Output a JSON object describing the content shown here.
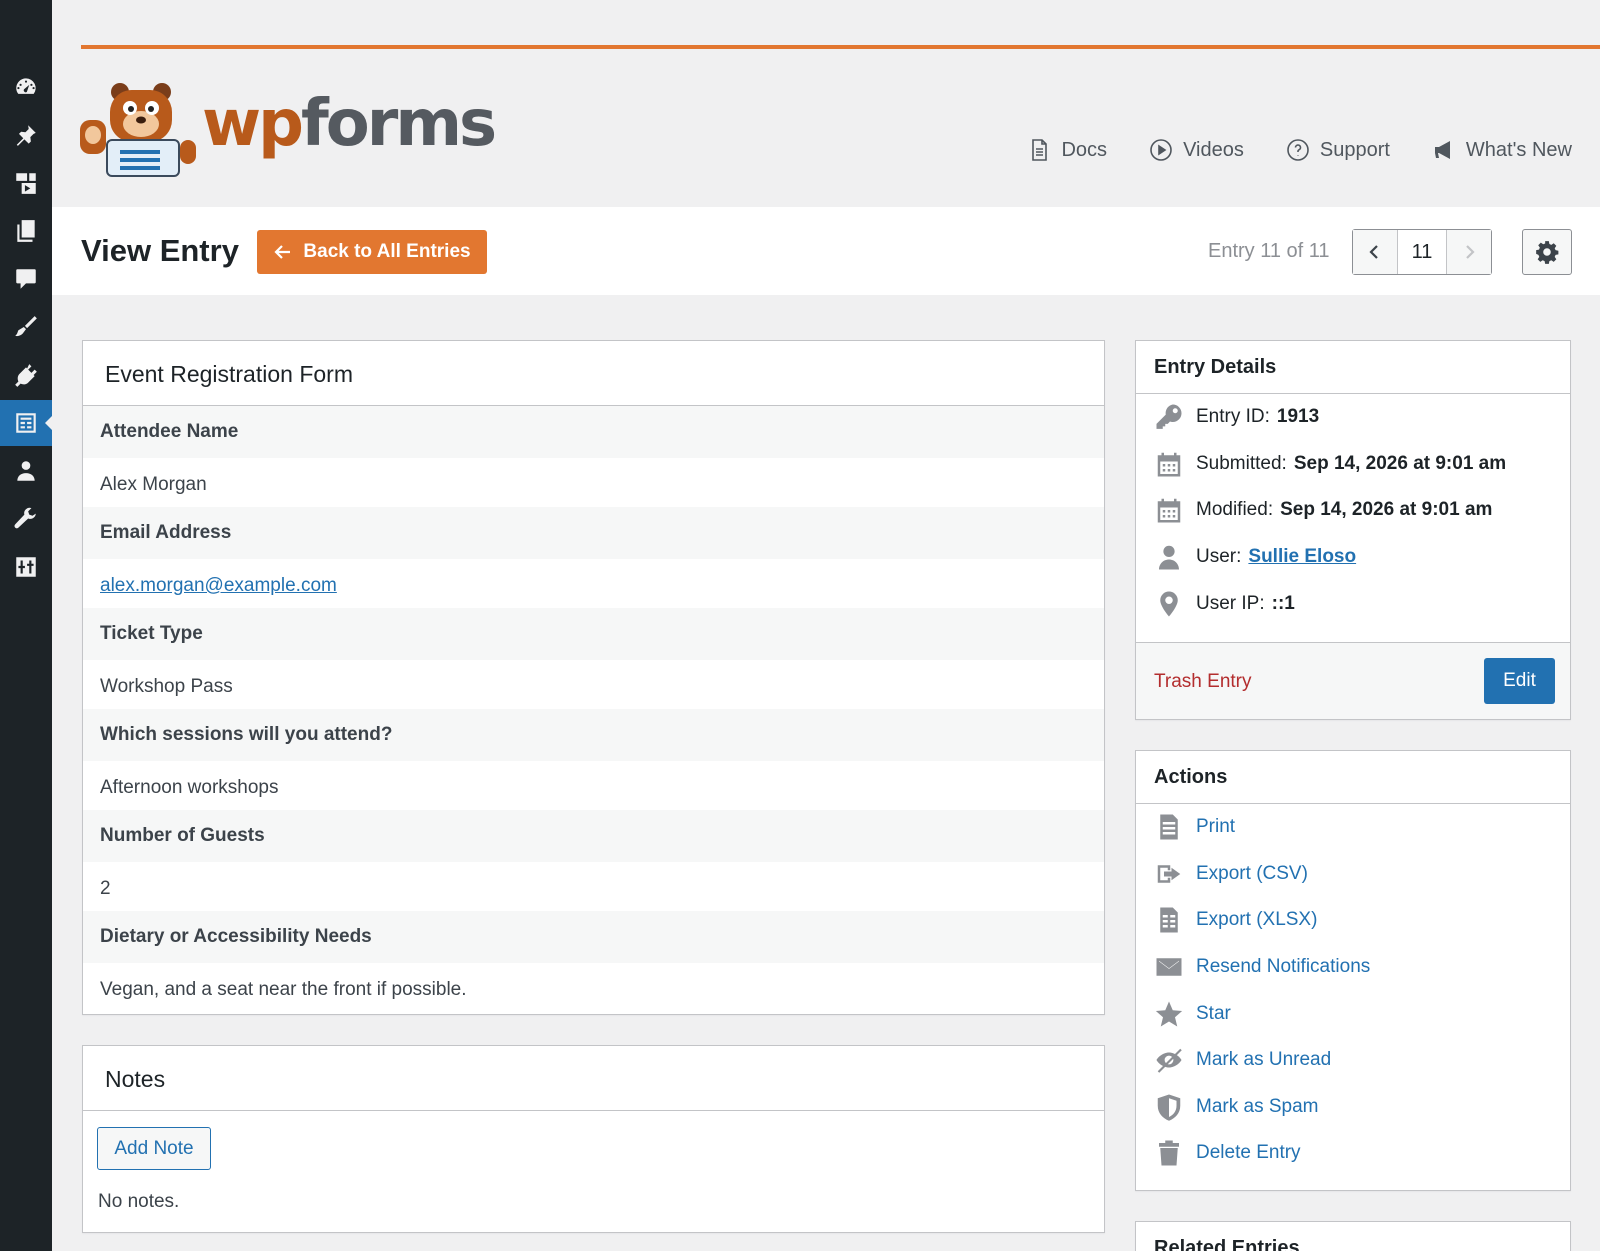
{
  "colors": {
    "accent": "#e27730",
    "link": "#2271b1",
    "danger": "#b32d2e",
    "sidebar": "#1d2327"
  },
  "sidebar": {
    "icons": [
      "dashboard-icon",
      "pin-icon",
      "media-icon",
      "pages-icon",
      "comments-icon",
      "appearance-icon",
      "plugins-icon",
      "wpforms-icon",
      "users-icon",
      "tools-icon",
      "settings-icon"
    ],
    "active": "wpforms-icon"
  },
  "brand": {
    "logo_wp": "wp",
    "logo_forms": "forms"
  },
  "header_links": {
    "docs": "Docs",
    "videos": "Videos",
    "support": "Support",
    "whats_new": "What's New"
  },
  "titlebar": {
    "title": "View Entry",
    "back_label": "Back to All Entries",
    "entry_count": "Entry 11 of 11",
    "current_page": "11"
  },
  "form": {
    "title": "Event Registration Form",
    "fields": [
      {
        "label": "Attendee Name",
        "value": "Alex Morgan"
      },
      {
        "label": "Email Address",
        "value": "alex.morgan@example.com"
      },
      {
        "label": "Ticket Type",
        "value": "Workshop Pass"
      },
      {
        "label": "Which sessions will you attend?",
        "value": "Afternoon workshops"
      },
      {
        "label": "Number of Guests",
        "value": "2"
      },
      {
        "label": "Dietary or Accessibility Needs",
        "value": "Vegan, and a seat near the front if possible."
      }
    ]
  },
  "notes": {
    "title": "Notes",
    "add_label": "Add Note",
    "empty": "No notes."
  },
  "entry_details": {
    "title": "Entry Details",
    "rows": [
      {
        "label": "Entry ID:",
        "value": "1913",
        "icon": "key-icon"
      },
      {
        "label": "Submitted:",
        "value": "Sep 14, 2026 at 9:01 am",
        "icon": "calendar-icon"
      },
      {
        "label": "Modified:",
        "value": "Sep 14, 2026 at 9:01 am",
        "icon": "calendar-icon"
      },
      {
        "label": "User:",
        "value": "Sullie Eloso",
        "icon": "user-icon"
      },
      {
        "label": "User IP:",
        "value": "::1",
        "icon": "location-icon"
      }
    ],
    "trash_label": "Trash Entry",
    "edit_label": "Edit"
  },
  "actions": {
    "title": "Actions",
    "items": [
      {
        "label": "Print",
        "icon": "print-icon"
      },
      {
        "label": "Export (CSV)",
        "icon": "export-icon"
      },
      {
        "label": "Export (XLSX)",
        "icon": "spreadsheet-icon"
      },
      {
        "label": "Resend Notifications",
        "icon": "envelope-icon"
      },
      {
        "label": "Star",
        "icon": "star-icon"
      },
      {
        "label": "Mark as Unread",
        "icon": "eye-slash-icon"
      },
      {
        "label": "Mark as Spam",
        "icon": "shield-icon"
      },
      {
        "label": "Delete Entry",
        "icon": "trash-icon"
      }
    ]
  },
  "related": {
    "title": "Related Entries"
  }
}
